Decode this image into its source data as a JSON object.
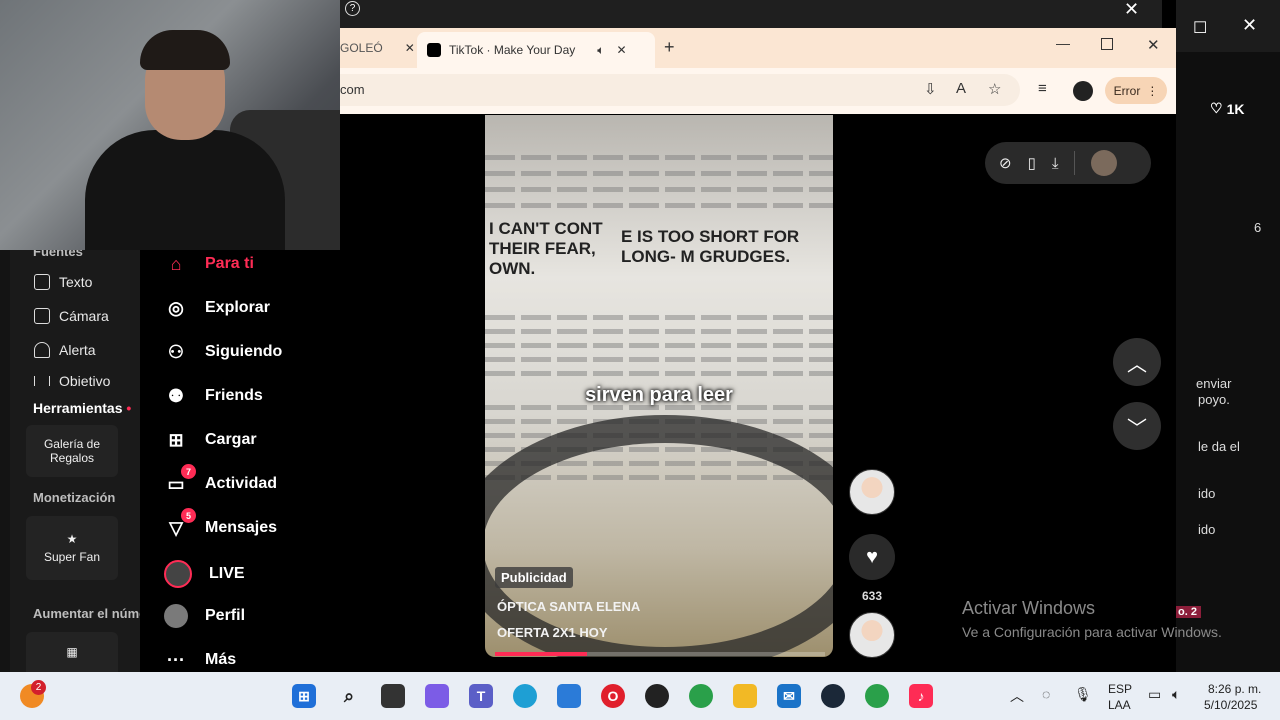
{
  "webcam": {
    "label": ""
  },
  "studio": {
    "sources_heading": "Fuentes",
    "items": [
      "Texto",
      "Cámara",
      "Alerta",
      "Objetivo"
    ],
    "tools_heading": "Herramientas",
    "gift_gallery": "Galería de Regalos",
    "monetization_heading": "Monetización",
    "super_fan": "Super Fan",
    "increase_heading": "Aumentar el núme"
  },
  "browser": {
    "other_tab_title": "GOLEÓ",
    "active_tab_title": "TikTok · Make Your Day",
    "url_text": "com",
    "error_label": "Error"
  },
  "nav": {
    "items": [
      {
        "label": "Para ti",
        "badge": ""
      },
      {
        "label": "Explorar",
        "badge": ""
      },
      {
        "label": "Siguiendo",
        "badge": ""
      },
      {
        "label": "Friends",
        "badge": ""
      },
      {
        "label": "Cargar",
        "badge": ""
      },
      {
        "label": "Actividad",
        "badge": "7"
      },
      {
        "label": "Mensajes",
        "badge": "5"
      },
      {
        "label": "LIVE",
        "badge": ""
      },
      {
        "label": "Perfil",
        "badge": ""
      },
      {
        "label": "Más",
        "badge": ""
      }
    ]
  },
  "video": {
    "caption": "sirven para leer",
    "ad_tag": "Publicidad",
    "advertiser": "ÓPTICA SANTA ELENA",
    "offer": "OFERTA 2X1 HOY",
    "progress_fraction": 0.28,
    "like_count": "633",
    "newspaper_headline_1": "I CAN'T CONT THEIR FEAR, OWN.",
    "newspaper_headline_2": "E IS TOO SHORT FOR LONG- M GRUDGES."
  },
  "right_app": {
    "likes": "1K",
    "count": "6",
    "text_1": "enviar",
    "text_2": "poyo.",
    "text_3": "le da el",
    "text_4": "ido",
    "text_5": "ido",
    "badge": "o. 2"
  },
  "watermark": {
    "title": "Activar Windows",
    "subtitle": "Ve a Configuración para activar Windows."
  },
  "taskbar": {
    "notif_badge": "2",
    "lang_1": "ESP",
    "lang_2": "LAA",
    "time": "8:26 p. m.",
    "date": "5/10/2025"
  }
}
